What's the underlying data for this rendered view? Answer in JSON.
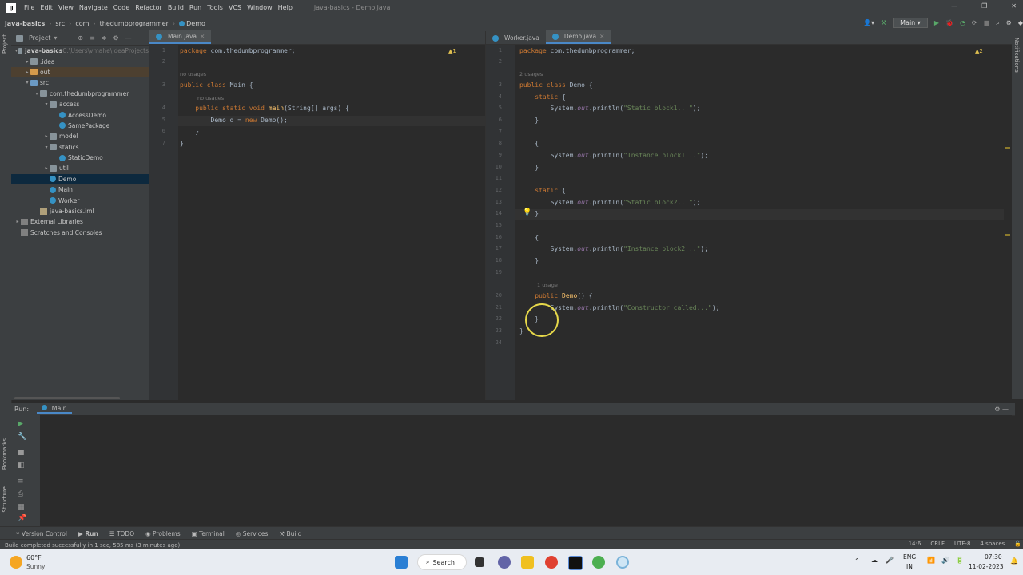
{
  "menubar": {
    "logo": "IJ",
    "items": [
      "File",
      "Edit",
      "View",
      "Navigate",
      "Code",
      "Refactor",
      "Build",
      "Run",
      "Tools",
      "VCS",
      "Window",
      "Help"
    ],
    "window_title": "java-basics - Demo.java"
  },
  "navbar": {
    "crumbs": [
      "java-basics",
      "src",
      "com",
      "thedumbprogrammer",
      "Demo"
    ],
    "run_config": "Main"
  },
  "left_strip": {
    "project": "Project",
    "bookmarks": "Bookmarks",
    "structure": "Structure"
  },
  "right_strip": {
    "notifications": "Notifications"
  },
  "project_panel": {
    "title": "Project",
    "tree": [
      {
        "label": "java-basics",
        "extra": "C:\\Users\\vmahe\\IdeaProjects",
        "indent": 0,
        "arrow": "▾",
        "icon": "folder",
        "bold": true
      },
      {
        "label": ".idea",
        "indent": 1,
        "arrow": "▸",
        "icon": "folder"
      },
      {
        "label": "out",
        "indent": 1,
        "arrow": "▸",
        "icon": "folder orange",
        "highlight": true
      },
      {
        "label": "src",
        "indent": 1,
        "arrow": "▾",
        "icon": "folder blue"
      },
      {
        "label": "com.thedumbprogrammer",
        "indent": 2,
        "arrow": "▾",
        "icon": "folder"
      },
      {
        "label": "access",
        "indent": 3,
        "arrow": "▾",
        "icon": "folder"
      },
      {
        "label": "AccessDemo",
        "indent": 4,
        "arrow": "",
        "icon": "cls"
      },
      {
        "label": "SamePackage",
        "indent": 4,
        "arrow": "",
        "icon": "cls"
      },
      {
        "label": "model",
        "indent": 3,
        "arrow": "▸",
        "icon": "folder"
      },
      {
        "label": "statics",
        "indent": 3,
        "arrow": "▾",
        "icon": "folder"
      },
      {
        "label": "StaticDemo",
        "indent": 4,
        "arrow": "",
        "icon": "cls"
      },
      {
        "label": "util",
        "indent": 3,
        "arrow": "▸",
        "icon": "folder"
      },
      {
        "label": "Demo",
        "indent": 3,
        "arrow": "",
        "icon": "cls",
        "selected": true
      },
      {
        "label": "Main",
        "indent": 3,
        "arrow": "",
        "icon": "cls"
      },
      {
        "label": "Worker",
        "indent": 3,
        "arrow": "",
        "icon": "cls"
      },
      {
        "label": "java-basics.iml",
        "indent": 2,
        "arrow": "",
        "icon": "iml"
      },
      {
        "label": "External Libraries",
        "indent": 0,
        "arrow": "▸",
        "icon": "lib"
      },
      {
        "label": "Scratches and Consoles",
        "indent": 0,
        "arrow": "",
        "icon": "lib"
      }
    ]
  },
  "editor_left": {
    "tabs": [
      {
        "label": "Main.java",
        "active": true
      }
    ],
    "warning": "▲1",
    "lines": [
      {
        "n": "1",
        "html": "<span class=\"kw\">package</span> com.thedumbprogrammer;"
      },
      {
        "n": "2",
        "html": ""
      },
      {
        "n": "3",
        "html": "<span class=\"kw\">public class</span> Main {"
      },
      {
        "n": "4",
        "html": "    <span class=\"kw\">public static void</span> <span class=\"fn\">main</span>(String[] args) {"
      },
      {
        "n": "5",
        "html": "        Demo d = <span class=\"kw\">new</span> Demo();"
      },
      {
        "n": "6",
        "html": "    }"
      },
      {
        "n": "7",
        "html": "}"
      }
    ],
    "hint_class": "no usages",
    "hint_method": "no usages"
  },
  "editor_right": {
    "tabs": [
      {
        "label": "Worker.java",
        "active": false
      },
      {
        "label": "Demo.java",
        "active": true
      }
    ],
    "warning": "▲2",
    "hint_class": "2 usages",
    "hint_ctor": "1 usage",
    "lines": [
      {
        "n": "1",
        "html": "<span class=\"kw\">package</span> com.thedumbprogrammer;"
      },
      {
        "n": "2",
        "html": ""
      },
      {
        "n": "3",
        "html": "<span class=\"kw\">public class</span> Demo {"
      },
      {
        "n": "4",
        "html": "    <span class=\"kw\">static</span> {"
      },
      {
        "n": "5",
        "html": "        System.<span class=\"fld\">out</span>.println(<span class=\"str\">\"Static block1...\"</span>);"
      },
      {
        "n": "6",
        "html": "    }"
      },
      {
        "n": "7",
        "html": ""
      },
      {
        "n": "8",
        "html": "    {"
      },
      {
        "n": "9",
        "html": "        System.<span class=\"fld\">out</span>.println(<span class=\"str\">\"Instance block1...\"</span>);"
      },
      {
        "n": "10",
        "html": "    }"
      },
      {
        "n": "11",
        "html": ""
      },
      {
        "n": "12",
        "html": "    <span class=\"kw\">static</span> {"
      },
      {
        "n": "13",
        "html": "        System.<span class=\"fld\">out</span>.println(<span class=\"str\">\"Static block2...\"</span>);"
      },
      {
        "n": "14",
        "html": "    }"
      },
      {
        "n": "15",
        "html": ""
      },
      {
        "n": "16",
        "html": "    {"
      },
      {
        "n": "17",
        "html": "        System.<span class=\"fld\">out</span>.println(<span class=\"str\">\"Instance block2...\"</span>);"
      },
      {
        "n": "18",
        "html": "    }"
      },
      {
        "n": "19",
        "html": ""
      },
      {
        "n": "20",
        "html": "    <span class=\"kw\">public</span> <span class=\"fn\">Demo</span>() {"
      },
      {
        "n": "21",
        "html": "        System.<span class=\"fld\">out</span>.println(<span class=\"str\">\"Constructor called...\"</span>);"
      },
      {
        "n": "22",
        "html": "    }"
      },
      {
        "n": "23",
        "html": "}"
      },
      {
        "n": "24",
        "html": ""
      }
    ]
  },
  "run_panel": {
    "label": "Run:",
    "tab": "Main"
  },
  "tool_tabs": [
    "Version Control",
    "Run",
    "TODO",
    "Problems",
    "Terminal",
    "Services",
    "Build"
  ],
  "status": {
    "message": "Build completed successfully in 1 sec, 585 ms (3 minutes ago)",
    "position": "14:6",
    "line_sep": "CRLF",
    "encoding": "UTF-8",
    "indent": "4 spaces"
  },
  "taskbar": {
    "weather_temp": "60°F",
    "weather_desc": "Sunny",
    "search": "Search",
    "lang": "ENG",
    "region": "IN",
    "time": "07:30",
    "date": "11-02-2023"
  }
}
